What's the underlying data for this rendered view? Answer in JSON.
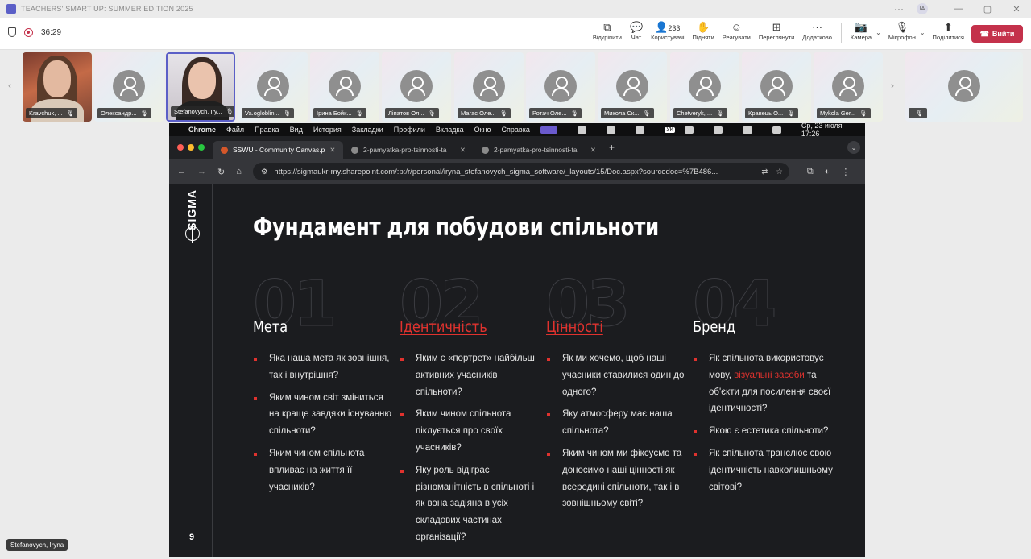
{
  "window": {
    "title": "TEACHERS' SMART UP: SUMMER EDITION 2025",
    "avatar": "IA"
  },
  "meeting": {
    "timer": "36:29"
  },
  "toolbar": {
    "share_label": "Відкріпити",
    "chat_label": "Чат",
    "people_label": "Користувачі",
    "people_count": "233",
    "raise_label": "Підняти",
    "react_label": "Реагувати",
    "view_label": "Переглянути",
    "more_label": "Додатково",
    "camera_label": "Камера",
    "mic_label": "Мікрофон",
    "share_screen_label": "Поділитися",
    "leave_label": "Вийти"
  },
  "participants": [
    {
      "name": "Kravchuk, ..."
    },
    {
      "name": "Олександр..."
    },
    {
      "name": "Stefanovych, Iry..."
    },
    {
      "name": "Va.ogloblin..."
    },
    {
      "name": "Ірина Бойк..."
    },
    {
      "name": "Ліпатов Ол..."
    },
    {
      "name": "Магас Оле..."
    },
    {
      "name": "Ротач Оле..."
    },
    {
      "name": "Микола Ск..."
    },
    {
      "name": "Chetveryk, ..."
    },
    {
      "name": "Кравець О..."
    },
    {
      "name": "Mykola Ger..."
    },
    {
      "name": ""
    }
  ],
  "mac": {
    "apple": "",
    "app": "Chrome",
    "menus": [
      "Файл",
      "Правка",
      "Вид",
      "История",
      "Закладки",
      "Профили",
      "Вкладка",
      "Окно",
      "Справка"
    ],
    "kb": "УК",
    "clock": "Ср, 23 июля  17:26"
  },
  "browser": {
    "tabs": [
      {
        "title": "SSWU - Community Canvas.p"
      },
      {
        "title": "2-pamyatka-pro-tsinnosti-ta"
      },
      {
        "title": "2-pamyatka-pro-tsinnosti-ta"
      }
    ],
    "url": "https://sigmaukr-my.sharepoint.com/:p:/r/personal/iryna_stefanovych_sigma_software/_layouts/15/Doc.aspx?sourcedoc=%7B486..."
  },
  "slide": {
    "brand": "SIGMA",
    "title": "Фундамент для побудови спільноти",
    "page": "9",
    "columns": [
      {
        "num": "01",
        "heading": "Мета",
        "items": [
          "Яка наша мета як зовнішня, так і внутрішня?",
          "Яким чином світ зміниться на краще завдяки існуванню спільноти?",
          "Яким чином спільнота впливає на життя її учасників?"
        ]
      },
      {
        "num": "02",
        "heading": "Ідентичність",
        "items": [
          "Яким є «портрет» найбільш активних учасників спільноти?",
          "Яким чином спільнота піклується про своїх учасників?",
          "Яку роль відіграє різноманітність в спільноті і як вона задіяна в усіх складових частинах організації?"
        ]
      },
      {
        "num": "03",
        "heading": "Цінності",
        "items": [
          "Як ми хочемо, щоб наші учасники ставилися один до одного?",
          "Яку атмосферу має наша спільнота?",
          "Яким чином ми фіксуємо та доносимо наші цінності як всередині спільноти, так і в зовнішньому світі?"
        ]
      },
      {
        "num": "04",
        "heading": "Бренд",
        "items": [
          "Як спільнота використовує мову,",
          "Якою є естетика спільноти?",
          "Як спільнота транслює свою ідентичність навколишньому світові?"
        ],
        "link": "візуальні засоби",
        "after_link": " та об'єкти для посилення своєї ідентичності?"
      }
    ]
  },
  "presenter_label": "Stefanovych, Iryna",
  "colors": {
    "accent": "#e0322e",
    "leave": "#c4314b",
    "teams": "#5b5fc7"
  }
}
